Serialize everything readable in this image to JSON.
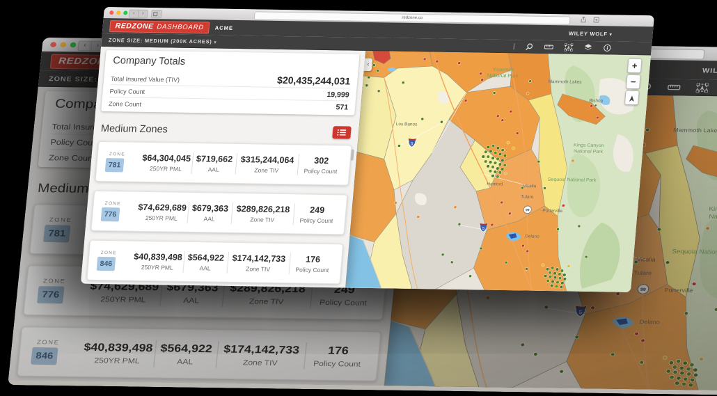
{
  "browser": {
    "url": "redzone.co",
    "back_glyph": "‹",
    "forward_glyph": "›"
  },
  "header": {
    "logo_primary": "REDZONE",
    "logo_secondary": "DASHBOARD",
    "account": "ACME",
    "user": "WILEY WOLF",
    "zone_size": "ZONE SIZE: MEDIUM (200K ACRES)",
    "dropdown_arrow": "▾"
  },
  "company_totals": {
    "title": "Company Totals",
    "rows": [
      {
        "label": "Total Insured Value (TIV)",
        "value": "$20,435,244,031"
      },
      {
        "label": "Policy Count",
        "value": "19,999"
      },
      {
        "label": "Zone Count",
        "value": "571"
      }
    ]
  },
  "zones_section": {
    "title": "Medium Zones",
    "badge_label": "ZONE",
    "columns": {
      "pml": "250YR PML",
      "aal": "AAL",
      "tiv": "Zone TIV",
      "policies": "Policy Count"
    },
    "zones": [
      {
        "id": "781",
        "pml": "$64,304,045",
        "aal": "$719,662",
        "tiv": "$315,244,064",
        "policies": "302"
      },
      {
        "id": "776",
        "pml": "$74,629,689",
        "aal": "$679,363",
        "tiv": "$289,826,218",
        "policies": "249"
      },
      {
        "id": "846",
        "pml": "$40,839,498",
        "aal": "$564,922",
        "tiv": "$174,142,733",
        "policies": "176"
      }
    ]
  },
  "map": {
    "labels": {
      "yosemite_line1": "Yosemite",
      "yosemite_line2": "National Park",
      "mammoth": "Mammoth Lakes",
      "bishop": "Bishop",
      "kings_canyon_line1": "Kings Canyon",
      "kings_canyon_line2": "National Park",
      "sequoia": "Sequoia National Park",
      "los_banos": "Los Banos",
      "hanford": "Hanford",
      "visalia": "Visalia",
      "tulare": "Tulare",
      "porterville": "Porterville",
      "delano": "Delano"
    },
    "shields": {
      "interstate": "5",
      "state_route": "99"
    },
    "controls": {
      "zoom_in": "+",
      "zoom_out": "−",
      "collapse": "‹"
    }
  },
  "colors": {
    "brand_red": "#D23B30",
    "header_bar": "#3F3F3F",
    "zone_badge_blue": "#A7C7E2",
    "list_button_red": "#CE352C"
  }
}
